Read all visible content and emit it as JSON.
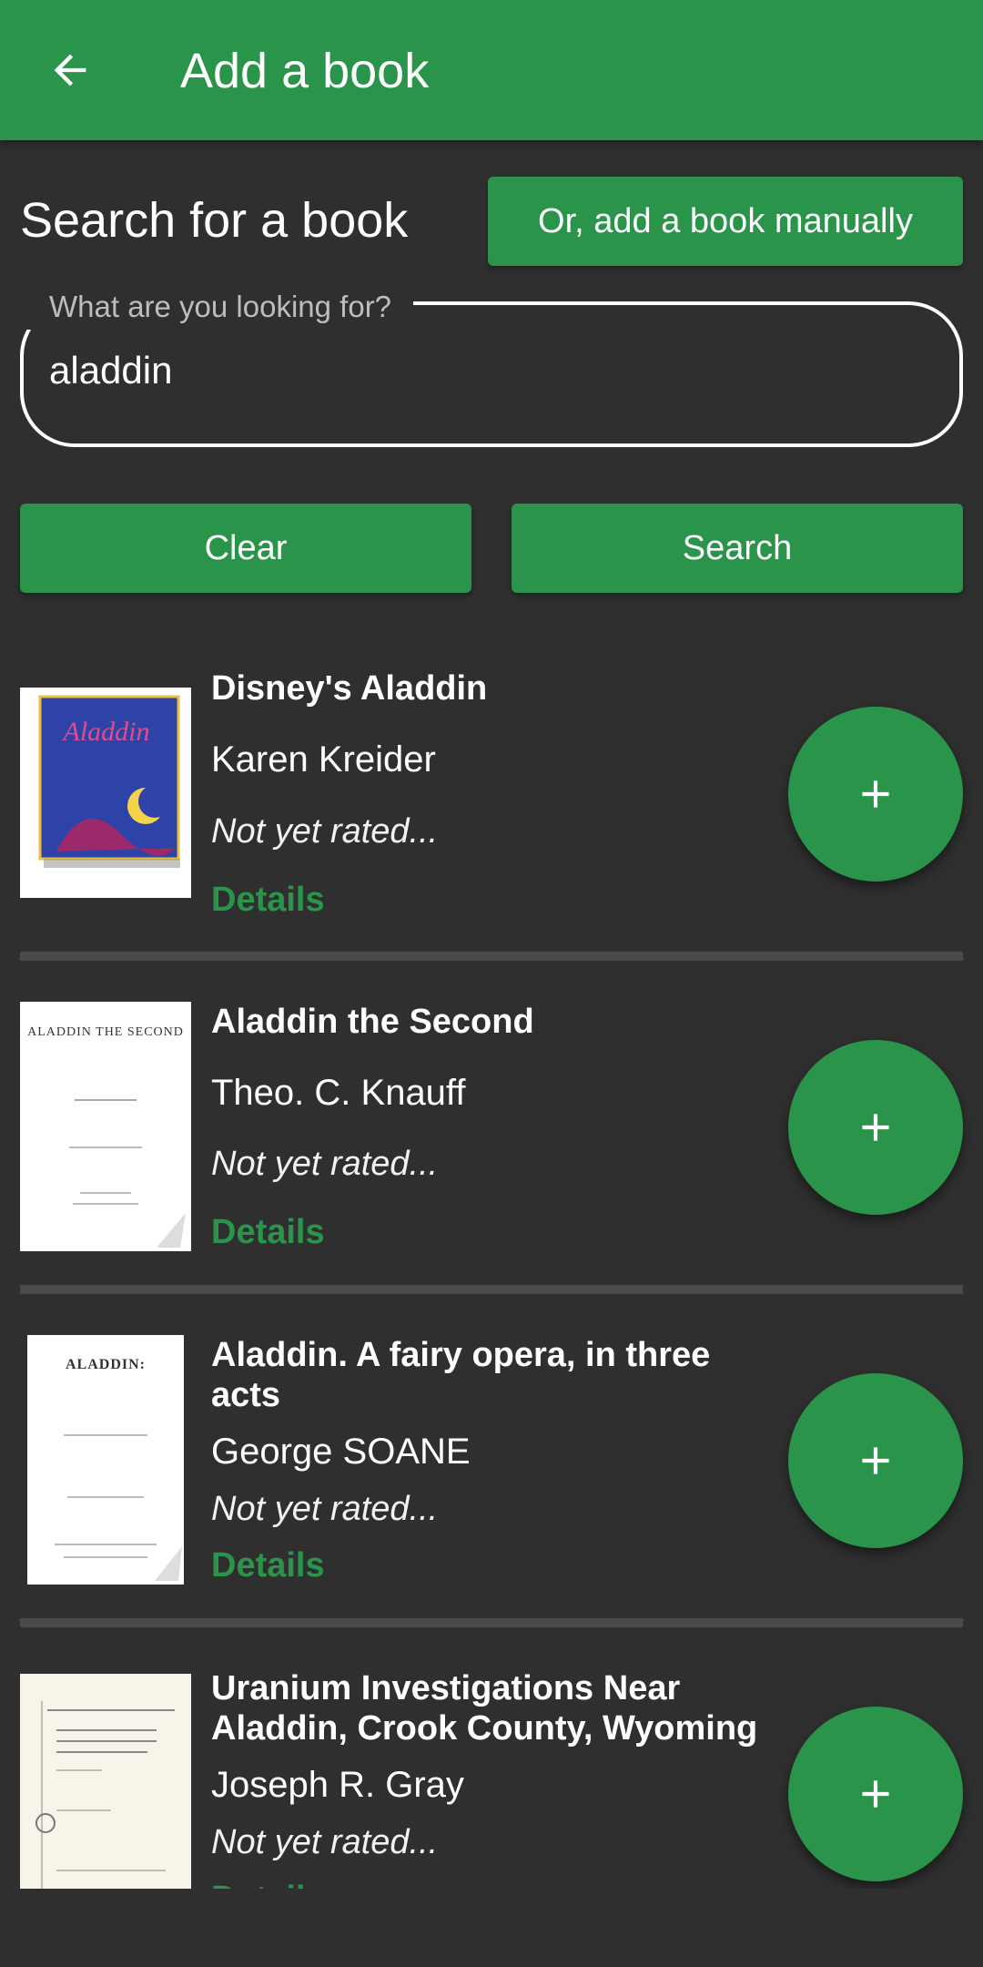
{
  "app_bar": {
    "title": "Add a book",
    "back_icon": "arrow-back-icon"
  },
  "search": {
    "heading": "Search for a book",
    "manual_button": "Or, add a book manually",
    "field_label": "What are you looking for?",
    "field_value": "aladdin",
    "clear_button": "Clear",
    "search_button": "Search"
  },
  "results": [
    {
      "title": "Disney's Aladdin",
      "author": "Karen Kreider",
      "rating": "Not yet rated...",
      "details": "Details"
    },
    {
      "title": "Aladdin the Second",
      "author": "Theo. C. Knauff",
      "rating": "Not yet rated...",
      "details": "Details",
      "cover_text": "ALADDIN THE SECOND"
    },
    {
      "title": "Aladdin. A fairy opera, in three acts",
      "author": "George SOANE",
      "rating": "Not yet rated...",
      "details": "Details",
      "cover_text": "ALADDIN:"
    },
    {
      "title": "Uranium Investigations Near Aladdin, Crook County, Wyoming",
      "author": "Joseph R. Gray",
      "rating": "Not yet rated...",
      "details": "Details"
    }
  ],
  "colors": {
    "accent": "#2a954a",
    "background": "#2f2f2f",
    "divider": "#4a4a4a"
  }
}
